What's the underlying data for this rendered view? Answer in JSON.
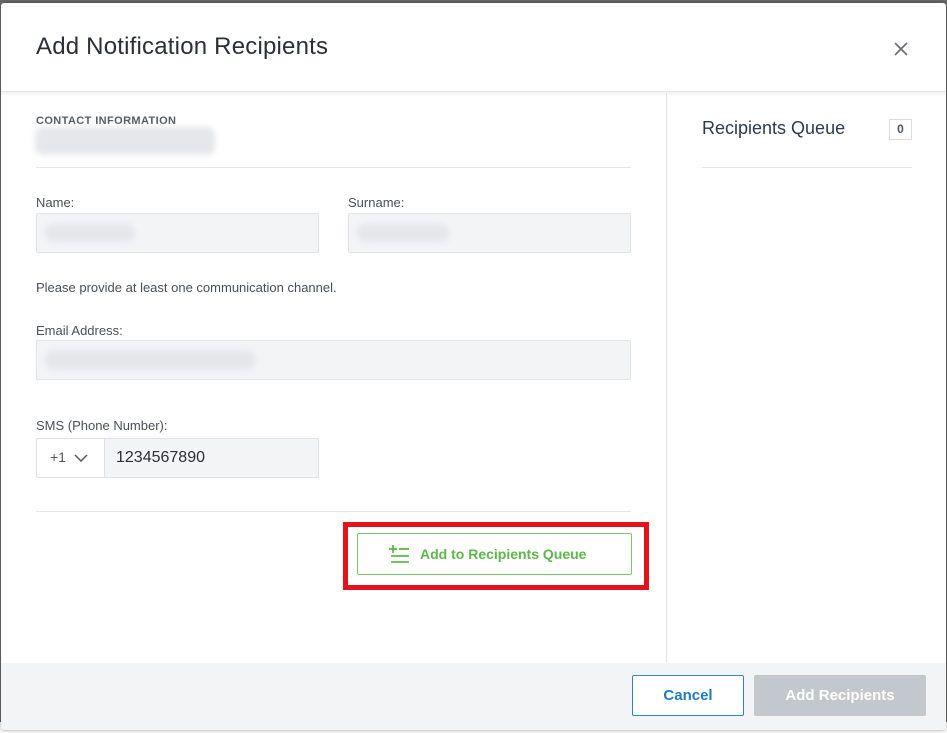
{
  "modal": {
    "title": "Add Notification Recipients"
  },
  "form": {
    "section_label": "CONTACT INFORMATION",
    "name_label": "Name:",
    "surname_label": "Surname:",
    "hint": "Please provide at least one communication channel.",
    "email_label": "Email Address:",
    "sms_label": "SMS (Phone Number):",
    "country_code": "+1",
    "phone_value": "1234567890",
    "add_to_queue_label": "Add to Recipients Queue"
  },
  "queue": {
    "title": "Recipients Queue",
    "count": "0"
  },
  "footer": {
    "cancel_label": "Cancel",
    "submit_label": "Add Recipients"
  },
  "colors": {
    "accent_blue": "#1f7ac0",
    "green": "#5bb849",
    "highlight_red": "#e3121b",
    "disabled_gray": "#c3c8cf"
  },
  "icons": {
    "close": "close-icon",
    "add_list": "add-list-icon",
    "chevron": "chevron-down-icon"
  }
}
